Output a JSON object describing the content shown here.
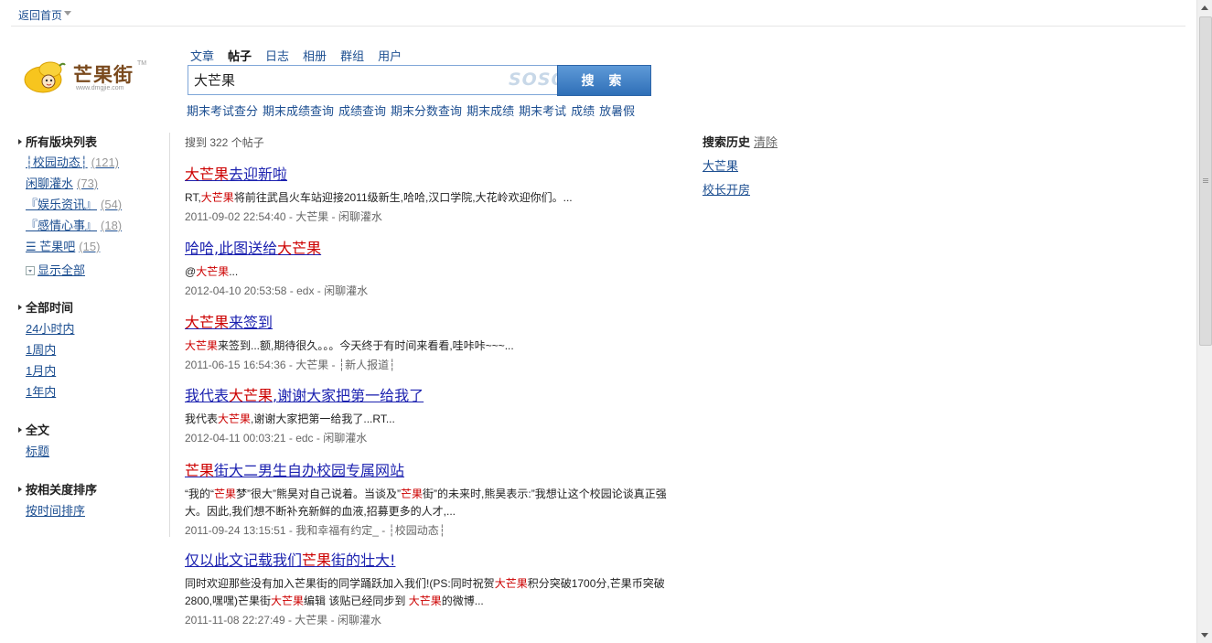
{
  "topbar": {
    "back_home": "返回首页"
  },
  "logo": {
    "brand": "芒果街",
    "url": "www.dmgjie.com",
    "tm": "TM"
  },
  "search": {
    "tabs": [
      {
        "label": "文章",
        "active": false
      },
      {
        "label": "帖子",
        "active": true
      },
      {
        "label": "日志",
        "active": false
      },
      {
        "label": "相册",
        "active": false
      },
      {
        "label": "群组",
        "active": false
      },
      {
        "label": "用户",
        "active": false
      }
    ],
    "query": "大芒果",
    "engine_watermark": "SOSO",
    "button_label": "搜 索",
    "suggestions": [
      "期末考试查分",
      "期末成绩查询",
      "成绩查询",
      "期末分数查询",
      "期末成绩",
      "期末考试",
      "成绩",
      "放暑假"
    ]
  },
  "sidebar": {
    "boards_title": "所有版块列表",
    "boards": [
      {
        "label": "┆校园动态┆",
        "count": "(121)"
      },
      {
        "label": "闲聊灌水",
        "count": "(73)"
      },
      {
        "label": "『娱乐资讯』",
        "count": "(54)"
      },
      {
        "label": "『感情心事』",
        "count": "(18)"
      },
      {
        "label": "☰ 芒果吧",
        "count": "(15)"
      }
    ],
    "show_all": "显示全部",
    "time_title": "全部时间",
    "time_items": [
      "24小时内",
      "1周内",
      "1月内",
      "1年内"
    ],
    "scope_title": "全文",
    "scope_items": [
      "标题"
    ],
    "sort_title": "按相关度排序",
    "sort_items": [
      "按时间排序"
    ]
  },
  "results": {
    "count_text": "搜到 322 个帖子",
    "items": [
      {
        "title_parts": [
          {
            "t": "大芒果",
            "hl": true
          },
          {
            "t": "去迎新啦",
            "hl": false
          }
        ],
        "snippet_parts": [
          {
            "t": "RT,",
            "hl": false
          },
          {
            "t": "大芒果",
            "hl": true
          },
          {
            "t": "将前往武昌火车站迎接2011级新生,哈哈,汉口学院,大花岭欢迎你们。...",
            "hl": false
          }
        ],
        "meta": "2011-09-02 22:54:40 - 大芒果 - 闲聊灌水"
      },
      {
        "title_parts": [
          {
            "t": "哈哈,此图送给",
            "hl": false
          },
          {
            "t": "大芒果",
            "hl": true
          }
        ],
        "snippet_parts": [
          {
            "t": "@",
            "hl": false
          },
          {
            "t": "大芒果",
            "hl": true
          },
          {
            "t": "...",
            "hl": false
          }
        ],
        "meta": "2012-04-10 20:53:58 - edx - 闲聊灌水"
      },
      {
        "title_parts": [
          {
            "t": "大芒果",
            "hl": true
          },
          {
            "t": "来签到",
            "hl": false
          }
        ],
        "snippet_parts": [
          {
            "t": "大芒果",
            "hl": true
          },
          {
            "t": "来签到...额,期待很久。。。今天终于有时间来看看,哇咔咔~~~...",
            "hl": false
          }
        ],
        "meta": "2011-06-15 16:54:36 - 大芒果 - ┆新人报道┆"
      },
      {
        "title_parts": [
          {
            "t": "我代表",
            "hl": false
          },
          {
            "t": "大芒果",
            "hl": true
          },
          {
            "t": ",谢谢大家把第一给我了",
            "hl": false
          }
        ],
        "snippet_parts": [
          {
            "t": "我代表",
            "hl": false
          },
          {
            "t": "大芒果",
            "hl": true
          },
          {
            "t": ",谢谢大家把第一给我了...RT...",
            "hl": false
          }
        ],
        "meta": "2012-04-11 00:03:21 - edc - 闲聊灌水"
      },
      {
        "title_parts": [
          {
            "t": "芒果",
            "hl": true
          },
          {
            "t": "街大二男生自办校园专属网站",
            "hl": false
          }
        ],
        "snippet_parts": [
          {
            "t": "“我的“",
            "hl": false
          },
          {
            "t": "芒果",
            "hl": true
          },
          {
            "t": "梦”很大”熊昊对自己说着。当谈及”",
            "hl": false
          },
          {
            "t": "芒果",
            "hl": true
          },
          {
            "t": "街”的未来时,熊昊表示:”我想让这个校园论谈真正强大。因此,我们想不断补充新鲜的血液,招募更多的人才,...",
            "hl": false
          }
        ],
        "meta": "2011-09-24 13:15:51 - 我和幸福有约定_ - ┆校园动态┆"
      },
      {
        "title_parts": [
          {
            "t": "仅以此文记载我们",
            "hl": false
          },
          {
            "t": "芒果",
            "hl": true
          },
          {
            "t": "街的壮大!",
            "hl": false
          }
        ],
        "snippet_parts": [
          {
            "t": "同时欢迎那些没有加入芒果街的同学踊跃加入我们!(PS:同时祝贺",
            "hl": false
          },
          {
            "t": "大芒果",
            "hl": true
          },
          {
            "t": "积分突破1700分,芒果币突破2800,嘿嘿)芒果街",
            "hl": false
          },
          {
            "t": "大芒果",
            "hl": true
          },
          {
            "t": "编辑 该贴已经同步到 ",
            "hl": false
          },
          {
            "t": "大芒果",
            "hl": true
          },
          {
            "t": "的微博...",
            "hl": false
          }
        ],
        "meta": "2011-11-08 22:27:49 - 大芒果 - 闲聊灌水"
      }
    ]
  },
  "history": {
    "title": "搜索历史",
    "clear": "清除",
    "items": [
      "大芒果",
      "校长开房"
    ]
  },
  "colors": {
    "highlight": "#cc0000",
    "link": "#1c22b0",
    "button": "#3f80c9"
  }
}
